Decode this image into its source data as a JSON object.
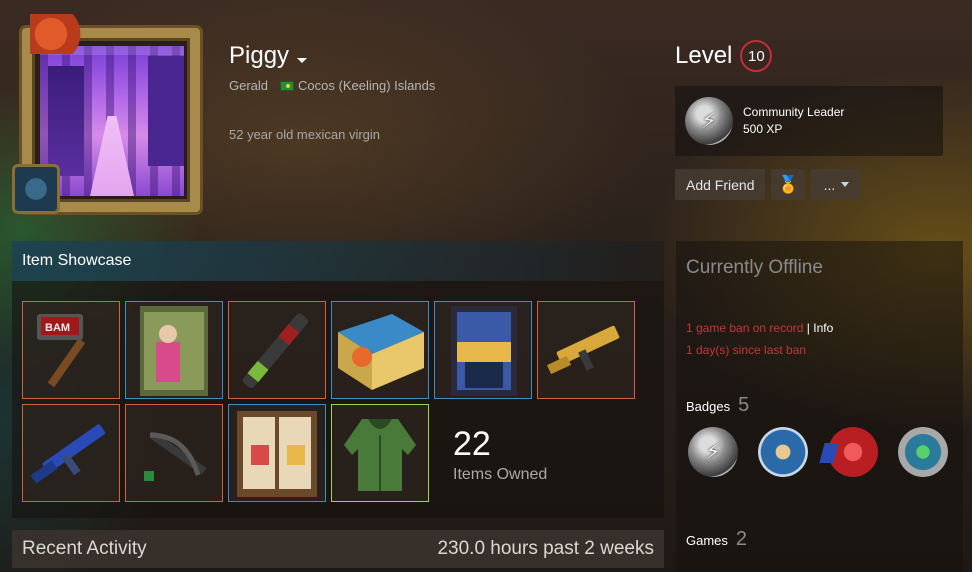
{
  "profile": {
    "name": "Piggy",
    "real_name": "Gerald",
    "location": "Cocos (Keeling) Islands",
    "summary": "52 year old mexican virgin"
  },
  "level": {
    "label": "Level",
    "value": "10"
  },
  "favorite_badge": {
    "name": "Community Leader",
    "xp": "500 XP",
    "icon": "lightning-bolt-icon"
  },
  "actions": {
    "add_friend": "Add Friend",
    "award_icon": "award-icon",
    "more": "..."
  },
  "showcase": {
    "title": "Item Showcase",
    "items": [
      {
        "name": "sledgehammer",
        "rarity": "orange"
      },
      {
        "name": "poster",
        "rarity": "blue"
      },
      {
        "name": "rocket-launcher",
        "rarity": "orange"
      },
      {
        "name": "crate",
        "rarity": "blue"
      },
      {
        "name": "door",
        "rarity": "blue"
      },
      {
        "name": "mp5-gold",
        "rarity": "orange"
      },
      {
        "name": "ak-blue",
        "rarity": "orange"
      },
      {
        "name": "crossbow",
        "rarity": "orange"
      },
      {
        "name": "wooden-wall",
        "rarity": "blue"
      },
      {
        "name": "green-hoodie",
        "rarity": "green"
      }
    ],
    "count": "22",
    "count_label": "Items Owned",
    "colors": {
      "orange": "#d2603a",
      "blue": "#3a8ec8",
      "green": "#9ed44a"
    }
  },
  "recent_activity": {
    "title": "Recent Activity",
    "hours": "230.0 hours past 2 weeks"
  },
  "sidebar": {
    "status": "Currently Offline",
    "ban_line1": "1 game ban on record",
    "ban_separator": "|",
    "ban_info": "Info",
    "ban_line2": "1 day(s) since last ban",
    "badges_label": "Badges",
    "badges_count": "5",
    "badges": [
      "lightning-bolt-icon",
      "csgo-icon",
      "wax-seal-icon",
      "porthole-icon"
    ],
    "games_label": "Games",
    "games_count": "2"
  }
}
